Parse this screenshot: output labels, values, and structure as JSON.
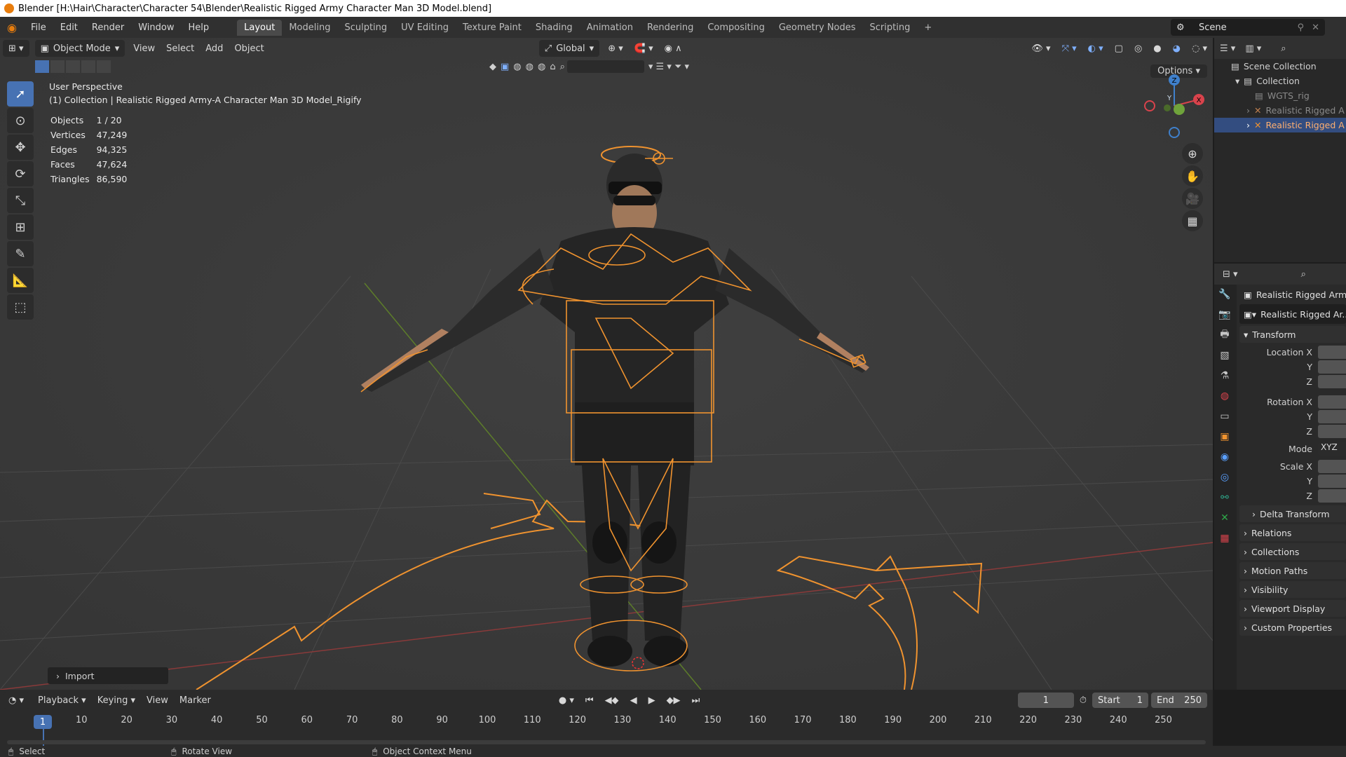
{
  "window": {
    "title": "Blender [H:\\Hair\\Character\\Character 54\\Blender\\Realistic Rigged Army Character Man 3D Model.blend]"
  },
  "menu": [
    "File",
    "Edit",
    "Render",
    "Window",
    "Help"
  ],
  "workspaces": [
    "Layout",
    "Modeling",
    "Sculpting",
    "UV Editing",
    "Texture Paint",
    "Shading",
    "Animation",
    "Rendering",
    "Compositing",
    "Geometry Nodes",
    "Scripting"
  ],
  "active_workspace": "Layout",
  "scene": {
    "name": "Scene"
  },
  "viewport_header": {
    "mode": "Object Mode",
    "menus": [
      "View",
      "Select",
      "Add",
      "Object"
    ],
    "orientation": "Global",
    "options": "Options"
  },
  "viewport_overlay": {
    "perspective": "User Perspective",
    "collection_line": "(1) Collection | Realistic Rigged Army-A Character Man 3D Model_Rigify"
  },
  "stats": [
    {
      "label": "Objects",
      "value": "1 / 20"
    },
    {
      "label": "Vertices",
      "value": "47,249"
    },
    {
      "label": "Edges",
      "value": "94,325"
    },
    {
      "label": "Faces",
      "value": "47,624"
    },
    {
      "label": "Triangles",
      "value": "86,590"
    }
  ],
  "gizmo_axes": {
    "x": "X",
    "y": "Y",
    "z": "Z"
  },
  "last_operator": "Import",
  "outliner": {
    "rows": [
      {
        "label": "Scene Collection",
        "icon": "scene-collection-icon"
      },
      {
        "label": "Collection",
        "icon": "collection-icon"
      },
      {
        "label": "WGTS_rig",
        "icon": "collection-icon"
      },
      {
        "label": "Realistic Rigged A",
        "icon": "armature-icon"
      },
      {
        "label": "Realistic Rigged A",
        "icon": "armature-icon"
      }
    ]
  },
  "properties": {
    "object_name": "Realistic Rigged Arm...",
    "data_name": "Realistic Rigged Ar...",
    "transform_title": "Transform",
    "transform_fields": [
      {
        "label": "Location X"
      },
      {
        "label": "Y"
      },
      {
        "label": "Z"
      },
      {
        "label": "Rotation X"
      },
      {
        "label": "Y"
      },
      {
        "label": "Z"
      },
      {
        "label": "Mode",
        "value": "XYZ"
      },
      {
        "label": "Scale X"
      },
      {
        "label": "Y"
      },
      {
        "label": "Z"
      }
    ],
    "panels": [
      "Delta Transform",
      "Relations",
      "Collections",
      "Motion Paths",
      "Visibility",
      "Viewport Display",
      "Custom Properties"
    ]
  },
  "timeline": {
    "menus": [
      "Playback",
      "Keying",
      "View",
      "Marker"
    ],
    "current_frame": "1",
    "start_label": "Start",
    "start": "1",
    "end_label": "End",
    "end": "250",
    "ticks": [
      "1",
      "10",
      "20",
      "30",
      "40",
      "50",
      "60",
      "70",
      "80",
      "90",
      "100",
      "110",
      "120",
      "130",
      "140",
      "150",
      "160",
      "170",
      "180",
      "190",
      "200",
      "210",
      "220",
      "230",
      "240",
      "250"
    ]
  },
  "status": {
    "select": "Select",
    "rotate": "Rotate View",
    "context": "Object Context Menu"
  },
  "colors": {
    "accent": "#4772b3",
    "selection_orange": "#f0932f",
    "axis_x": "#d9434c",
    "axis_y": "#6fa33b",
    "axis_z": "#3f80cc"
  }
}
